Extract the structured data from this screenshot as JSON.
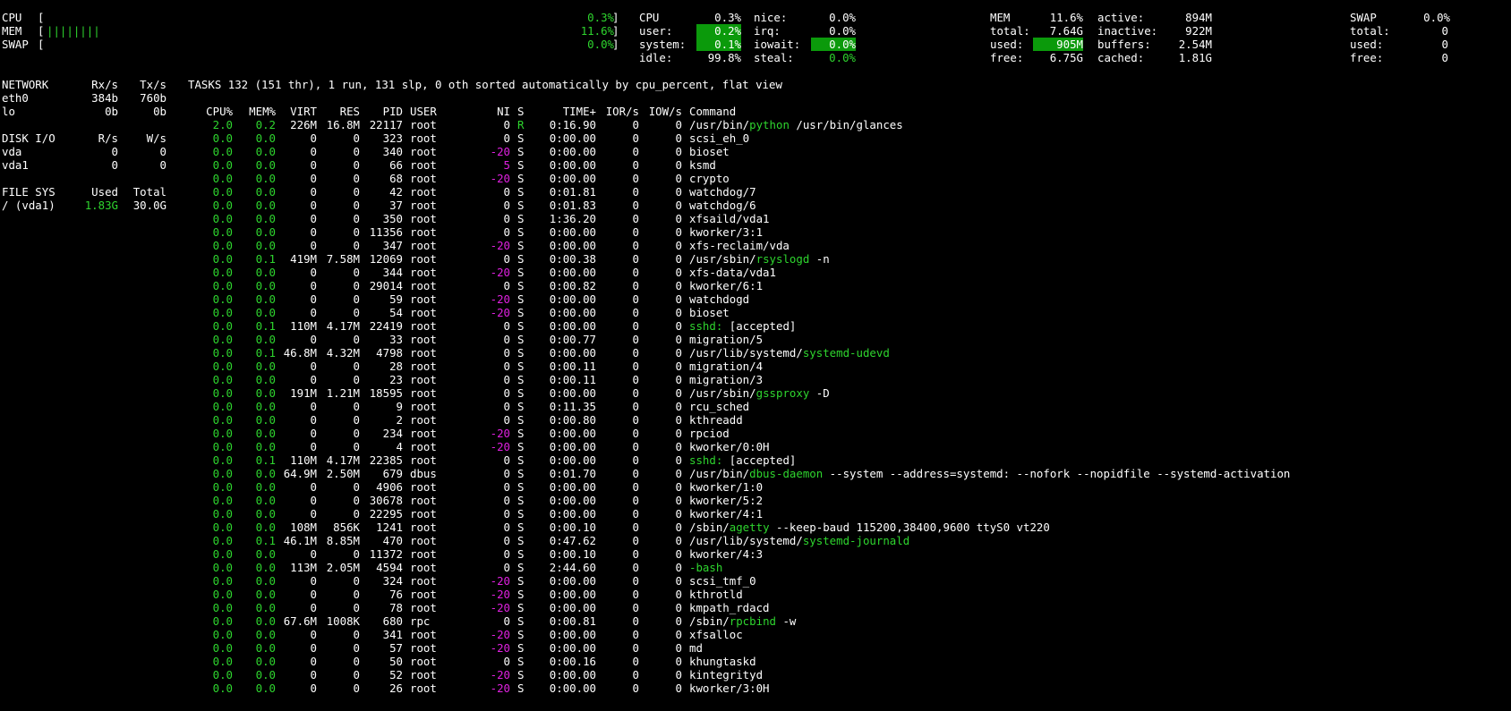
{
  "quicklook": {
    "cpu_label": "CPU",
    "cpu_pct": "0.3%",
    "mem_label": "MEM",
    "mem_bar": "||||||||",
    "mem_pct": "11.6%",
    "swap_label": "SWAP",
    "swap_pct": "0.0%"
  },
  "cpu": {
    "title": "CPU",
    "total": "0.3%",
    "user_label": "user:",
    "user": "0.2%",
    "system_label": "system:",
    "system": "0.1%",
    "idle_label": "idle:",
    "idle": "99.8%",
    "nice_label": "nice:",
    "nice": "0.0%",
    "irq_label": "irq:",
    "irq": "0.0%",
    "iowait_label": "iowait:",
    "iowait": "0.0%",
    "steal_label": "steal:",
    "steal": "0.0%"
  },
  "mem": {
    "title": "MEM",
    "pct": "11.6%",
    "total_label": "total:",
    "total": "7.64G",
    "used_label": "used:",
    "used": "905M",
    "free_label": "free:",
    "free": "6.75G",
    "active_label": "active:",
    "active": "894M",
    "inactive_label": "inactive:",
    "inactive": "922M",
    "buffers_label": "buffers:",
    "buffers": "2.54M",
    "cached_label": "cached:",
    "cached": "1.81G"
  },
  "swap": {
    "title": "SWAP",
    "pct": "0.0%",
    "total_label": "total:",
    "total": "0",
    "used_label": "used:",
    "used": "0",
    "free_label": "free:",
    "free": "0"
  },
  "network": {
    "title": "NETWORK",
    "rx_header": "Rx/s",
    "tx_header": "Tx/s",
    "rows": [
      {
        "name": "eth0",
        "rx": "384b",
        "tx": "760b"
      },
      {
        "name": "lo",
        "rx": "0b",
        "tx": "0b"
      }
    ]
  },
  "diskio": {
    "title": "DISK I/O",
    "r_header": "R/s",
    "w_header": "W/s",
    "rows": [
      {
        "name": "vda",
        "r": "0",
        "w": "0"
      },
      {
        "name": "vda1",
        "r": "0",
        "w": "0"
      }
    ]
  },
  "fs": {
    "title": "FILE SYS",
    "used_header": "Used",
    "total_header": "Total",
    "rows": [
      {
        "name": "/ (vda1)",
        "used": "1.83G",
        "total": "30.0G"
      }
    ]
  },
  "tasks": {
    "summary": "TASKS 132 (151 thr), 1 run, 131 slp, 0 oth sorted automatically by cpu_percent, flat view"
  },
  "process_headers": {
    "cpu": "CPU%",
    "mem": "MEM%",
    "virt": "VIRT",
    "res": "RES",
    "pid": "PID",
    "user": "USER",
    "ni": "NI",
    "s": "S",
    "time": "TIME+",
    "ior": "IOR/s",
    "iow": "IOW/s",
    "cmd": "Command"
  },
  "processes": [
    {
      "cpu": "2.0",
      "mem": "0.2",
      "virt": "226M",
      "res": "16.8M",
      "pid": "22117",
      "user": "root",
      "ni": "0",
      "s": "R",
      "time": "0:16.90",
      "ior": "0",
      "iow": "0",
      "cmd_pre": "/usr/bin/",
      "cmd_hl": "python",
      "cmd_post": " /usr/bin/glances"
    },
    {
      "cpu": "0.0",
      "mem": "0.0",
      "virt": "0",
      "res": "0",
      "pid": "323",
      "user": "root",
      "ni": "0",
      "s": "S",
      "time": "0:00.00",
      "ior": "0",
      "iow": "0",
      "cmd_pre": "scsi_eh_0",
      "cmd_hl": "",
      "cmd_post": ""
    },
    {
      "cpu": "0.0",
      "mem": "0.0",
      "virt": "0",
      "res": "0",
      "pid": "340",
      "user": "root",
      "ni": "-20",
      "s": "S",
      "time": "0:00.00",
      "ior": "0",
      "iow": "0",
      "cmd_pre": "bioset",
      "cmd_hl": "",
      "cmd_post": ""
    },
    {
      "cpu": "0.0",
      "mem": "0.0",
      "virt": "0",
      "res": "0",
      "pid": "66",
      "user": "root",
      "ni": "5",
      "s": "S",
      "time": "0:00.00",
      "ior": "0",
      "iow": "0",
      "cmd_pre": "ksmd",
      "cmd_hl": "",
      "cmd_post": ""
    },
    {
      "cpu": "0.0",
      "mem": "0.0",
      "virt": "0",
      "res": "0",
      "pid": "68",
      "user": "root",
      "ni": "-20",
      "s": "S",
      "time": "0:00.00",
      "ior": "0",
      "iow": "0",
      "cmd_pre": "crypto",
      "cmd_hl": "",
      "cmd_post": ""
    },
    {
      "cpu": "0.0",
      "mem": "0.0",
      "virt": "0",
      "res": "0",
      "pid": "42",
      "user": "root",
      "ni": "0",
      "s": "S",
      "time": "0:01.81",
      "ior": "0",
      "iow": "0",
      "cmd_pre": "watchdog/7",
      "cmd_hl": "",
      "cmd_post": ""
    },
    {
      "cpu": "0.0",
      "mem": "0.0",
      "virt": "0",
      "res": "0",
      "pid": "37",
      "user": "root",
      "ni": "0",
      "s": "S",
      "time": "0:01.83",
      "ior": "0",
      "iow": "0",
      "cmd_pre": "watchdog/6",
      "cmd_hl": "",
      "cmd_post": ""
    },
    {
      "cpu": "0.0",
      "mem": "0.0",
      "virt": "0",
      "res": "0",
      "pid": "350",
      "user": "root",
      "ni": "0",
      "s": "S",
      "time": "1:36.20",
      "ior": "0",
      "iow": "0",
      "cmd_pre": "xfsaild/vda1",
      "cmd_hl": "",
      "cmd_post": ""
    },
    {
      "cpu": "0.0",
      "mem": "0.0",
      "virt": "0",
      "res": "0",
      "pid": "11356",
      "user": "root",
      "ni": "0",
      "s": "S",
      "time": "0:00.00",
      "ior": "0",
      "iow": "0",
      "cmd_pre": "kworker/3:1",
      "cmd_hl": "",
      "cmd_post": ""
    },
    {
      "cpu": "0.0",
      "mem": "0.0",
      "virt": "0",
      "res": "0",
      "pid": "347",
      "user": "root",
      "ni": "-20",
      "s": "S",
      "time": "0:00.00",
      "ior": "0",
      "iow": "0",
      "cmd_pre": "xfs-reclaim/vda",
      "cmd_hl": "",
      "cmd_post": ""
    },
    {
      "cpu": "0.0",
      "mem": "0.1",
      "virt": "419M",
      "res": "7.58M",
      "pid": "12069",
      "user": "root",
      "ni": "0",
      "s": "S",
      "time": "0:00.38",
      "ior": "0",
      "iow": "0",
      "cmd_pre": "/usr/sbin/",
      "cmd_hl": "rsyslogd",
      "cmd_post": " -n"
    },
    {
      "cpu": "0.0",
      "mem": "0.0",
      "virt": "0",
      "res": "0",
      "pid": "344",
      "user": "root",
      "ni": "-20",
      "s": "S",
      "time": "0:00.00",
      "ior": "0",
      "iow": "0",
      "cmd_pre": "xfs-data/vda1",
      "cmd_hl": "",
      "cmd_post": ""
    },
    {
      "cpu": "0.0",
      "mem": "0.0",
      "virt": "0",
      "res": "0",
      "pid": "29014",
      "user": "root",
      "ni": "0",
      "s": "S",
      "time": "0:00.82",
      "ior": "0",
      "iow": "0",
      "cmd_pre": "kworker/6:1",
      "cmd_hl": "",
      "cmd_post": ""
    },
    {
      "cpu": "0.0",
      "mem": "0.0",
      "virt": "0",
      "res": "0",
      "pid": "59",
      "user": "root",
      "ni": "-20",
      "s": "S",
      "time": "0:00.00",
      "ior": "0",
      "iow": "0",
      "cmd_pre": "watchdogd",
      "cmd_hl": "",
      "cmd_post": ""
    },
    {
      "cpu": "0.0",
      "mem": "0.0",
      "virt": "0",
      "res": "0",
      "pid": "54",
      "user": "root",
      "ni": "-20",
      "s": "S",
      "time": "0:00.00",
      "ior": "0",
      "iow": "0",
      "cmd_pre": "bioset",
      "cmd_hl": "",
      "cmd_post": ""
    },
    {
      "cpu": "0.0",
      "mem": "0.1",
      "virt": "110M",
      "res": "4.17M",
      "pid": "22419",
      "user": "root",
      "ni": "0",
      "s": "S",
      "time": "0:00.00",
      "ior": "0",
      "iow": "0",
      "cmd_pre": "",
      "cmd_hl": "sshd:",
      "cmd_post": " [accepted]"
    },
    {
      "cpu": "0.0",
      "mem": "0.0",
      "virt": "0",
      "res": "0",
      "pid": "33",
      "user": "root",
      "ni": "0",
      "s": "S",
      "time": "0:00.77",
      "ior": "0",
      "iow": "0",
      "cmd_pre": "migration/5",
      "cmd_hl": "",
      "cmd_post": ""
    },
    {
      "cpu": "0.0",
      "mem": "0.1",
      "virt": "46.8M",
      "res": "4.32M",
      "pid": "4798",
      "user": "root",
      "ni": "0",
      "s": "S",
      "time": "0:00.00",
      "ior": "0",
      "iow": "0",
      "cmd_pre": "/usr/lib/systemd/",
      "cmd_hl": "systemd-udevd",
      "cmd_post": ""
    },
    {
      "cpu": "0.0",
      "mem": "0.0",
      "virt": "0",
      "res": "0",
      "pid": "28",
      "user": "root",
      "ni": "0",
      "s": "S",
      "time": "0:00.11",
      "ior": "0",
      "iow": "0",
      "cmd_pre": "migration/4",
      "cmd_hl": "",
      "cmd_post": ""
    },
    {
      "cpu": "0.0",
      "mem": "0.0",
      "virt": "0",
      "res": "0",
      "pid": "23",
      "user": "root",
      "ni": "0",
      "s": "S",
      "time": "0:00.11",
      "ior": "0",
      "iow": "0",
      "cmd_pre": "migration/3",
      "cmd_hl": "",
      "cmd_post": ""
    },
    {
      "cpu": "0.0",
      "mem": "0.0",
      "virt": "191M",
      "res": "1.21M",
      "pid": "18595",
      "user": "root",
      "ni": "0",
      "s": "S",
      "time": "0:00.00",
      "ior": "0",
      "iow": "0",
      "cmd_pre": "/usr/sbin/",
      "cmd_hl": "gssproxy",
      "cmd_post": " -D"
    },
    {
      "cpu": "0.0",
      "mem": "0.0",
      "virt": "0",
      "res": "0",
      "pid": "9",
      "user": "root",
      "ni": "0",
      "s": "S",
      "time": "0:11.35",
      "ior": "0",
      "iow": "0",
      "cmd_pre": "rcu_sched",
      "cmd_hl": "",
      "cmd_post": ""
    },
    {
      "cpu": "0.0",
      "mem": "0.0",
      "virt": "0",
      "res": "0",
      "pid": "2",
      "user": "root",
      "ni": "0",
      "s": "S",
      "time": "0:00.80",
      "ior": "0",
      "iow": "0",
      "cmd_pre": "kthreadd",
      "cmd_hl": "",
      "cmd_post": ""
    },
    {
      "cpu": "0.0",
      "mem": "0.0",
      "virt": "0",
      "res": "0",
      "pid": "234",
      "user": "root",
      "ni": "-20",
      "s": "S",
      "time": "0:00.00",
      "ior": "0",
      "iow": "0",
      "cmd_pre": "rpciod",
      "cmd_hl": "",
      "cmd_post": ""
    },
    {
      "cpu": "0.0",
      "mem": "0.0",
      "virt": "0",
      "res": "0",
      "pid": "4",
      "user": "root",
      "ni": "-20",
      "s": "S",
      "time": "0:00.00",
      "ior": "0",
      "iow": "0",
      "cmd_pre": "kworker/0:0H",
      "cmd_hl": "",
      "cmd_post": ""
    },
    {
      "cpu": "0.0",
      "mem": "0.1",
      "virt": "110M",
      "res": "4.17M",
      "pid": "22385",
      "user": "root",
      "ni": "0",
      "s": "S",
      "time": "0:00.00",
      "ior": "0",
      "iow": "0",
      "cmd_pre": "",
      "cmd_hl": "sshd:",
      "cmd_post": " [accepted]"
    },
    {
      "cpu": "0.0",
      "mem": "0.0",
      "virt": "64.9M",
      "res": "2.50M",
      "pid": "679",
      "user": "dbus",
      "ni": "0",
      "s": "S",
      "time": "0:01.70",
      "ior": "0",
      "iow": "0",
      "cmd_pre": "/usr/bin/",
      "cmd_hl": "dbus-daemon",
      "cmd_post": " --system --address=systemd: --nofork --nopidfile --systemd-activation"
    },
    {
      "cpu": "0.0",
      "mem": "0.0",
      "virt": "0",
      "res": "0",
      "pid": "4906",
      "user": "root",
      "ni": "0",
      "s": "S",
      "time": "0:00.00",
      "ior": "0",
      "iow": "0",
      "cmd_pre": "kworker/1:0",
      "cmd_hl": "",
      "cmd_post": ""
    },
    {
      "cpu": "0.0",
      "mem": "0.0",
      "virt": "0",
      "res": "0",
      "pid": "30678",
      "user": "root",
      "ni": "0",
      "s": "S",
      "time": "0:00.00",
      "ior": "0",
      "iow": "0",
      "cmd_pre": "kworker/5:2",
      "cmd_hl": "",
      "cmd_post": ""
    },
    {
      "cpu": "0.0",
      "mem": "0.0",
      "virt": "0",
      "res": "0",
      "pid": "22295",
      "user": "root",
      "ni": "0",
      "s": "S",
      "time": "0:00.00",
      "ior": "0",
      "iow": "0",
      "cmd_pre": "kworker/4:1",
      "cmd_hl": "",
      "cmd_post": ""
    },
    {
      "cpu": "0.0",
      "mem": "0.0",
      "virt": "108M",
      "res": "856K",
      "pid": "1241",
      "user": "root",
      "ni": "0",
      "s": "S",
      "time": "0:00.10",
      "ior": "0",
      "iow": "0",
      "cmd_pre": "/sbin/",
      "cmd_hl": "agetty",
      "cmd_post": " --keep-baud 115200,38400,9600 ttyS0 vt220"
    },
    {
      "cpu": "0.0",
      "mem": "0.1",
      "virt": "46.1M",
      "res": "8.85M",
      "pid": "470",
      "user": "root",
      "ni": "0",
      "s": "S",
      "time": "0:47.62",
      "ior": "0",
      "iow": "0",
      "cmd_pre": "/usr/lib/systemd/",
      "cmd_hl": "systemd-journald",
      "cmd_post": ""
    },
    {
      "cpu": "0.0",
      "mem": "0.0",
      "virt": "0",
      "res": "0",
      "pid": "11372",
      "user": "root",
      "ni": "0",
      "s": "S",
      "time": "0:00.10",
      "ior": "0",
      "iow": "0",
      "cmd_pre": "kworker/4:3",
      "cmd_hl": "",
      "cmd_post": ""
    },
    {
      "cpu": "0.0",
      "mem": "0.0",
      "virt": "113M",
      "res": "2.05M",
      "pid": "4594",
      "user": "root",
      "ni": "0",
      "s": "S",
      "time": "2:44.60",
      "ior": "0",
      "iow": "0",
      "cmd_pre": "",
      "cmd_hl": "-bash",
      "cmd_post": ""
    },
    {
      "cpu": "0.0",
      "mem": "0.0",
      "virt": "0",
      "res": "0",
      "pid": "324",
      "user": "root",
      "ni": "-20",
      "s": "S",
      "time": "0:00.00",
      "ior": "0",
      "iow": "0",
      "cmd_pre": "scsi_tmf_0",
      "cmd_hl": "",
      "cmd_post": ""
    },
    {
      "cpu": "0.0",
      "mem": "0.0",
      "virt": "0",
      "res": "0",
      "pid": "76",
      "user": "root",
      "ni": "-20",
      "s": "S",
      "time": "0:00.00",
      "ior": "0",
      "iow": "0",
      "cmd_pre": "kthrotld",
      "cmd_hl": "",
      "cmd_post": ""
    },
    {
      "cpu": "0.0",
      "mem": "0.0",
      "virt": "0",
      "res": "0",
      "pid": "78",
      "user": "root",
      "ni": "-20",
      "s": "S",
      "time": "0:00.00",
      "ior": "0",
      "iow": "0",
      "cmd_pre": "kmpath_rdacd",
      "cmd_hl": "",
      "cmd_post": ""
    },
    {
      "cpu": "0.0",
      "mem": "0.0",
      "virt": "67.6M",
      "res": "1008K",
      "pid": "680",
      "user": "rpc",
      "ni": "0",
      "s": "S",
      "time": "0:00.81",
      "ior": "0",
      "iow": "0",
      "cmd_pre": "/sbin/",
      "cmd_hl": "rpcbind",
      "cmd_post": " -w"
    },
    {
      "cpu": "0.0",
      "mem": "0.0",
      "virt": "0",
      "res": "0",
      "pid": "341",
      "user": "root",
      "ni": "-20",
      "s": "S",
      "time": "0:00.00",
      "ior": "0",
      "iow": "0",
      "cmd_pre": "xfsalloc",
      "cmd_hl": "",
      "cmd_post": ""
    },
    {
      "cpu": "0.0",
      "mem": "0.0",
      "virt": "0",
      "res": "0",
      "pid": "57",
      "user": "root",
      "ni": "-20",
      "s": "S",
      "time": "0:00.00",
      "ior": "0",
      "iow": "0",
      "cmd_pre": "md",
      "cmd_hl": "",
      "cmd_post": ""
    },
    {
      "cpu": "0.0",
      "mem": "0.0",
      "virt": "0",
      "res": "0",
      "pid": "50",
      "user": "root",
      "ni": "0",
      "s": "S",
      "time": "0:00.16",
      "ior": "0",
      "iow": "0",
      "cmd_pre": "khungtaskd",
      "cmd_hl": "",
      "cmd_post": ""
    },
    {
      "cpu": "0.0",
      "mem": "0.0",
      "virt": "0",
      "res": "0",
      "pid": "52",
      "user": "root",
      "ni": "-20",
      "s": "S",
      "time": "0:00.00",
      "ior": "0",
      "iow": "0",
      "cmd_pre": "kintegrityd",
      "cmd_hl": "",
      "cmd_post": ""
    },
    {
      "cpu": "0.0",
      "mem": "0.0",
      "virt": "0",
      "res": "0",
      "pid": "26",
      "user": "root",
      "ni": "-20",
      "s": "S",
      "time": "0:00.00",
      "ior": "0",
      "iow": "0",
      "cmd_pre": "kworker/3:0H",
      "cmd_hl": "",
      "cmd_post": ""
    }
  ],
  "colors": {
    "background": "#000000",
    "text": "#ffffff",
    "ok_green": "#2ed52e",
    "highlight_bg": "#0b9a0b",
    "nice_magenta": "#e020e0"
  }
}
